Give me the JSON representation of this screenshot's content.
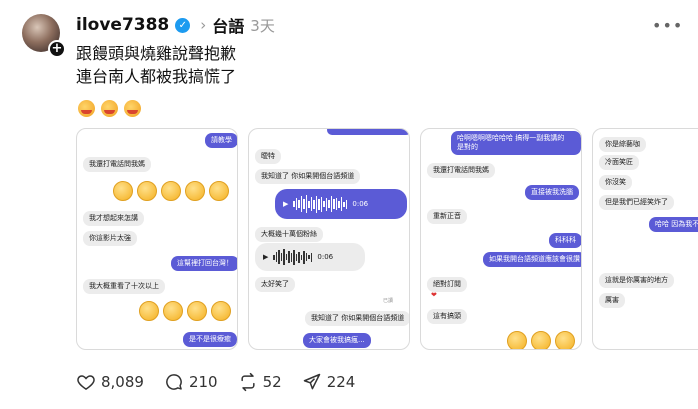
{
  "post": {
    "username": "ilove7388",
    "topic": "台語",
    "time": "3天",
    "text_line1": "跟饅頭與燒雞說聲抱歉",
    "text_line2": "連台南人都被我搞慌了"
  },
  "cards": {
    "c1": {
      "b1": "請教學",
      "b2": "我還打電話問我媽",
      "b3": "我才想起來怎講",
      "b4": "你這影片太強",
      "b5": "這幫裡打回台灣！",
      "b6": "我大概重看了十次以上",
      "b7": "是不是很療癒"
    },
    "c2": {
      "b1": "曖特",
      "b2": "我知道了 你如果開個台語頻道",
      "b3": "0:06",
      "b4": "大概幾十萬個粉絲",
      "b5": "0:06",
      "b6": "太好笑了",
      "b7": "我知道了 你如果開個台語頻道",
      "b8": "大家會被我搞瘋...",
      "read": "已讀"
    },
    "c3": {
      "b1": "哈啊嗯啊嗯哈哈哈 搞得一副我講的",
      "b1b": "是對的",
      "b2": "我還打電話問我媽",
      "b3": "直接被我洗腦",
      "b4": "重新正音",
      "b5": "科科科",
      "b6": "如果我開台語頻道應該會很讚",
      "b7": "絕對訂閱",
      "b8": "這有搞頭"
    },
    "c4": {
      "b1": "你是綜藝咖",
      "b2": "冷面笑匠",
      "b3": "你沒笑",
      "b4": "但是我們已經笑炸了",
      "b5": "哈哈 因為我不",
      "b6": "這就是你厲害的地方",
      "b7": "厲害"
    }
  },
  "actions": {
    "likes": "8,089",
    "comments": "210",
    "reposts": "52",
    "shares": "224"
  },
  "colors": {
    "accent_bubble": "#5b5bd6",
    "verified": "#1d9bf0"
  },
  "icons": [
    "verified-icon",
    "chevron-right-icon",
    "more-icon",
    "heart-icon",
    "comment-icon",
    "repost-icon",
    "share-icon"
  ]
}
